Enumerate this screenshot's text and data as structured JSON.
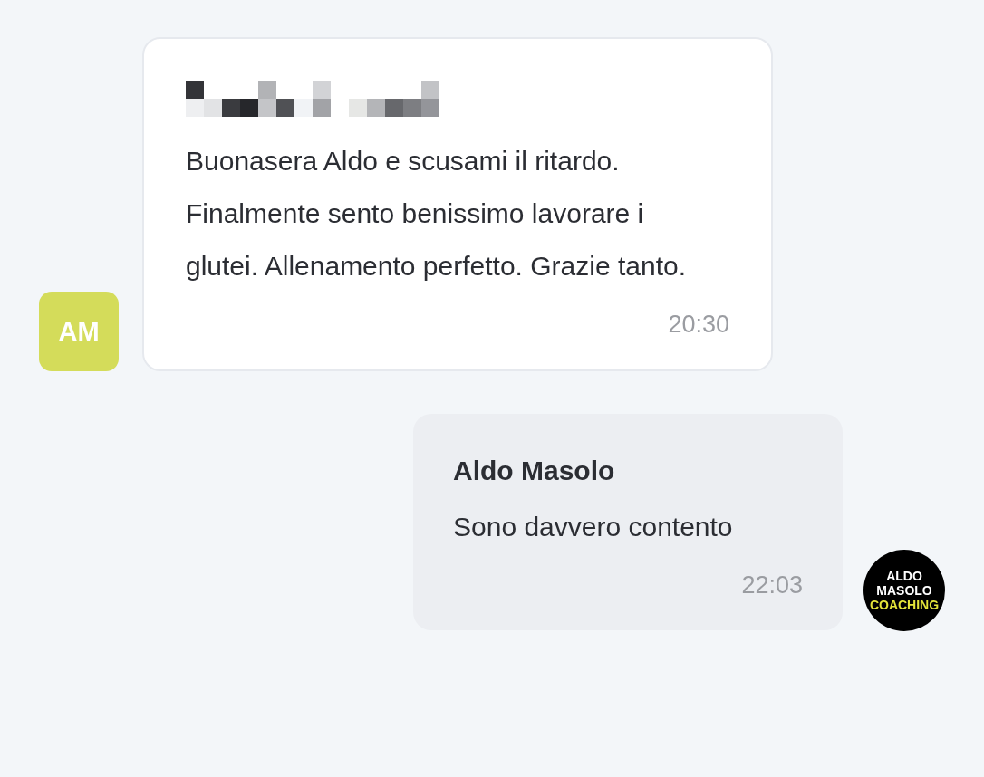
{
  "messages": [
    {
      "kind": "incoming",
      "sender_redacted": true,
      "text": "Buonasera Aldo e scusami il ritardo. Finalmente sento benissimo lavorare i glutei. Allenamento perfetto. Grazie tanto.",
      "time": "20:30",
      "avatar": {
        "initials": "AM",
        "color": "#d4dc5a"
      }
    },
    {
      "kind": "outgoing",
      "sender": "Aldo Masolo",
      "text": "Sono davvero contento",
      "time": "22:03",
      "logo": {
        "lines": [
          "ALDO",
          "MASOLO",
          "COACHING"
        ]
      }
    }
  ]
}
